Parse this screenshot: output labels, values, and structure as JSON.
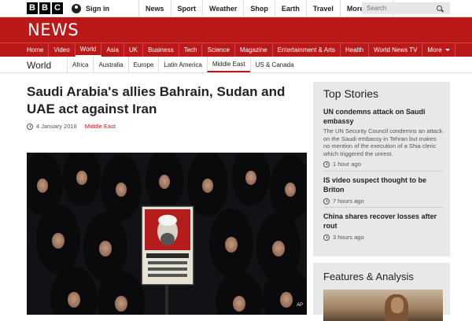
{
  "brand": {
    "letters": [
      "B",
      "B",
      "C"
    ],
    "news_title": "NEWS"
  },
  "account": {
    "signin_label": "Sign in"
  },
  "top_nav": [
    "News",
    "Sport",
    "Weather",
    "Shop",
    "Earth",
    "Travel",
    "More"
  ],
  "search": {
    "placeholder": "Search"
  },
  "main_nav": [
    "Home",
    "Video",
    "World",
    "Asia",
    "UK",
    "Business",
    "Tech",
    "Science",
    "Magazine",
    "Entertainment & Arts",
    "Health",
    "World News TV",
    "More"
  ],
  "main_nav_active": "World",
  "section": {
    "title": "World",
    "subnav": [
      "Africa",
      "Australia",
      "Europe",
      "Latin America",
      "Middle East",
      "US & Canada"
    ],
    "active": "Middle East"
  },
  "article": {
    "headline": "Saudi Arabia's allies Bahrain, Sudan and UAE act against Iran",
    "date": "4 January 2016",
    "category": "Middle East",
    "photo_credit": "AP"
  },
  "top_stories": {
    "title": "Top Stories",
    "items": [
      {
        "headline": "UN condemns attack on Saudi embassy",
        "summary": "The UN Security Council condemns an attack on the Saudi embassy in Tehran but makes no mention of the execution of a Shia cleric which triggered the unrest.",
        "time": "1 hour ago"
      },
      {
        "headline": "IS video suspect thought to be Briton",
        "summary": "",
        "time": "7 hours ago"
      },
      {
        "headline": "China shares recover losses after rout",
        "summary": "",
        "time": "3 hours ago"
      }
    ]
  },
  "features": {
    "title": "Features & Analysis"
  },
  "colors": {
    "brand_red": "#bb1919",
    "text": "#222222",
    "panel": "#e8e8e8"
  },
  "icons": {
    "signin": "user-icon",
    "search": "search-icon",
    "time": "clock-icon"
  }
}
